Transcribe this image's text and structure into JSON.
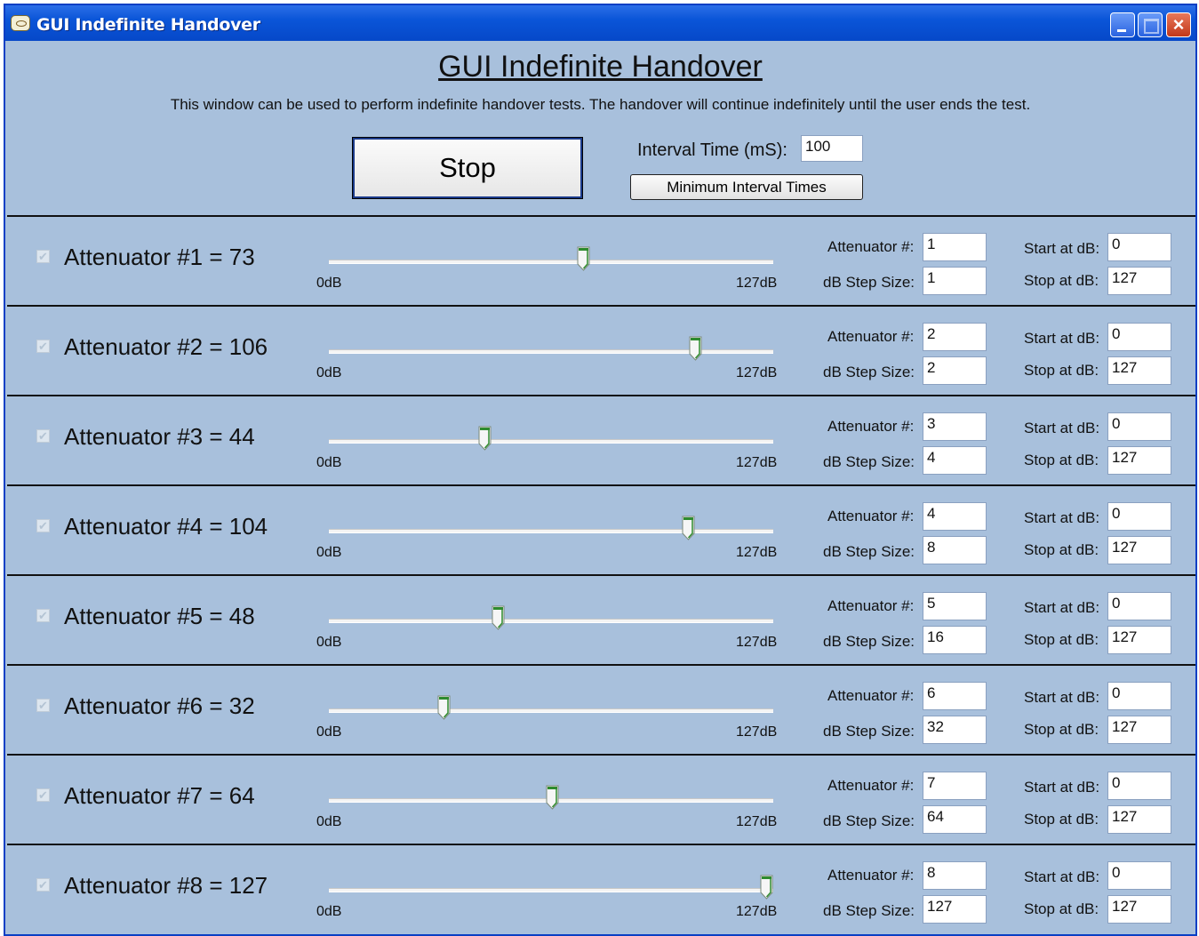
{
  "window": {
    "title": "GUI Indefinite Handover",
    "close_glyph": "×"
  },
  "header": {
    "title": "GUI Indefinite Handover",
    "description": "This window can be used to perform indefinite handover tests.  The handover will continue indefinitely until the user ends the test.",
    "stop_label": "Stop",
    "interval_label": "Interval Time (mS):",
    "interval_value": "100",
    "min_interval_label": "Minimum Interval Times"
  },
  "labels": {
    "attenuator_num": "Attenuator #:",
    "step_size": "dB Step Size:",
    "start_db": "Start at dB:",
    "stop_db": "Stop at dB:",
    "slider_min": "0dB",
    "slider_max": "127dB"
  },
  "slider_range": {
    "min": 0,
    "max": 127
  },
  "colors": {
    "thumb_accent": "#2e8b2e",
    "panel_bg": "#a8c0dc"
  },
  "attenuators": [
    {
      "label": "Attenuator #1 = 73",
      "value": 73,
      "number": "1",
      "step": "1",
      "start": "0",
      "stop": "127",
      "checked": true
    },
    {
      "label": "Attenuator #2 = 106",
      "value": 106,
      "number": "2",
      "step": "2",
      "start": "0",
      "stop": "127",
      "checked": true
    },
    {
      "label": "Attenuator #3 = 44",
      "value": 44,
      "number": "3",
      "step": "4",
      "start": "0",
      "stop": "127",
      "checked": true
    },
    {
      "label": "Attenuator #4 = 104",
      "value": 104,
      "number": "4",
      "step": "8",
      "start": "0",
      "stop": "127",
      "checked": true
    },
    {
      "label": "Attenuator #5 = 48",
      "value": 48,
      "number": "5",
      "step": "16",
      "start": "0",
      "stop": "127",
      "checked": true
    },
    {
      "label": "Attenuator #6 = 32",
      "value": 32,
      "number": "6",
      "step": "32",
      "start": "0",
      "stop": "127",
      "checked": true
    },
    {
      "label": "Attenuator #7 = 64",
      "value": 64,
      "number": "7",
      "step": "64",
      "start": "0",
      "stop": "127",
      "checked": true
    },
    {
      "label": "Attenuator #8 = 127",
      "value": 127,
      "number": "8",
      "step": "127",
      "start": "0",
      "stop": "127",
      "checked": true
    }
  ]
}
